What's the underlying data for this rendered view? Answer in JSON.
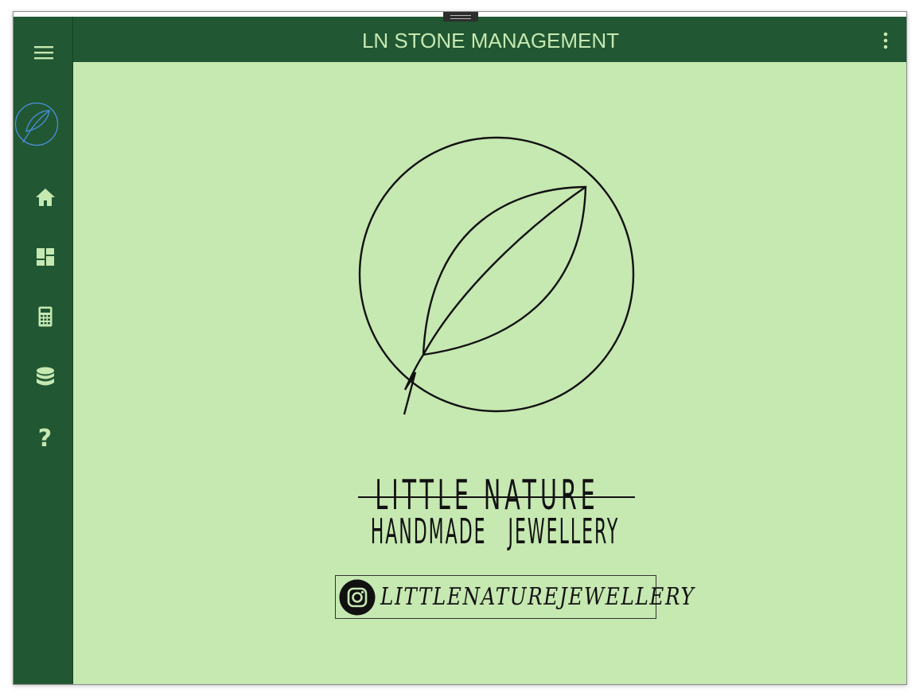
{
  "header": {
    "title": "LN STONE MANAGEMENT",
    "more_icon": "more-vert-icon"
  },
  "sidebar": {
    "items": [
      {
        "name": "menu",
        "icon": "hamburger-menu-icon"
      },
      {
        "name": "logo",
        "icon": "leaf-logo-icon"
      },
      {
        "name": "home",
        "icon": "home-icon"
      },
      {
        "name": "dashboard",
        "icon": "dashboard-icon"
      },
      {
        "name": "calculator",
        "icon": "calculator-icon"
      },
      {
        "name": "database",
        "icon": "database-icon"
      },
      {
        "name": "help",
        "icon": "help-icon",
        "label": "?"
      }
    ]
  },
  "brand": {
    "name": "LITTLE NATURE",
    "tagline": "HANDMADE   JEWELLERY",
    "instagram_handle": "LITTLENATUREJEWELLERY",
    "instagram_icon": "instagram-icon"
  },
  "colors": {
    "sidebar_bg": "#215732",
    "header_bg": "#215732",
    "content_bg": "#c6e8b1",
    "accent_text": "#c6e8b1",
    "logo_stroke": "#4a90e2"
  }
}
